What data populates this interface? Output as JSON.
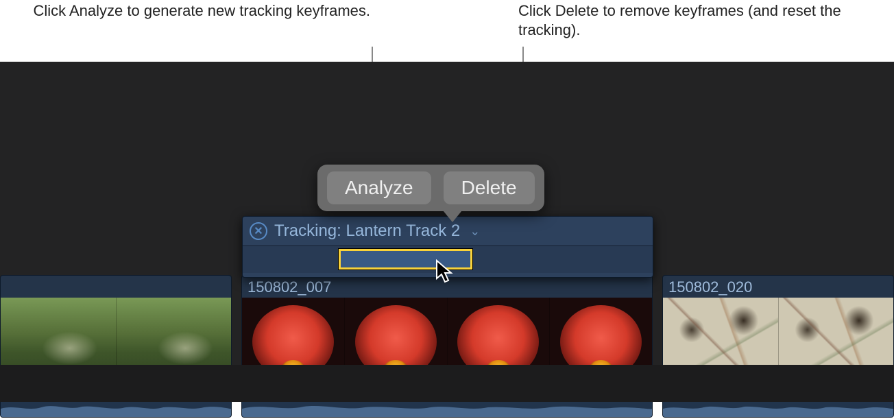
{
  "callouts": {
    "analyze": "Click Analyze to generate new tracking keyframes.",
    "delete": "Click Delete to remove keyframes (and reset the tracking)."
  },
  "popover": {
    "analyze_label": "Analyze",
    "delete_label": "Delete"
  },
  "tracking_editor": {
    "title": "Tracking: Lantern Track 2",
    "close_glyph": "✕",
    "chevron_glyph": "⌄"
  },
  "clips": [
    {
      "label": ""
    },
    {
      "label": "150802_007"
    },
    {
      "label": "150802_020"
    }
  ],
  "icons": {
    "cursor": "pointer-cursor-icon"
  }
}
